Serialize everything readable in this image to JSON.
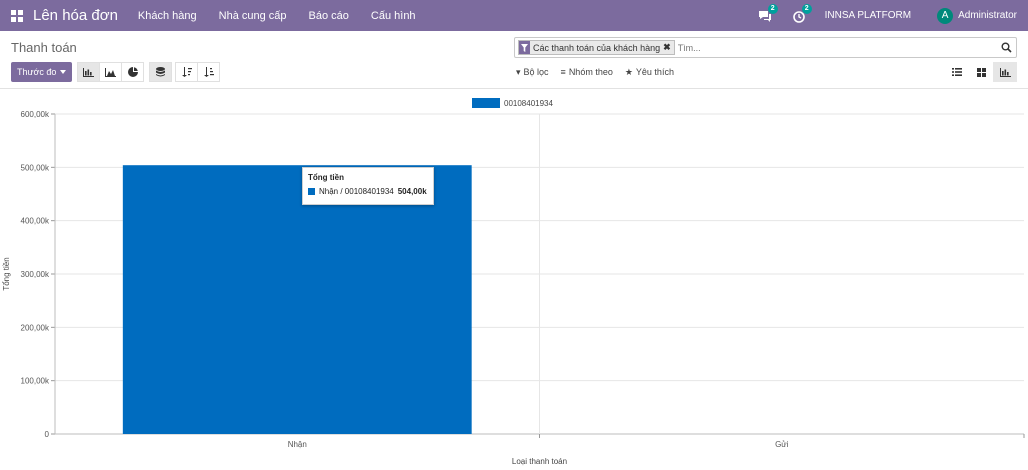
{
  "navbar": {
    "app_title": "Lên hóa đơn",
    "menus": [
      "Khách hàng",
      "Nhà cung cấp",
      "Báo cáo",
      "Cấu hình"
    ],
    "messages_badge": "2",
    "activities_badge": "2",
    "company": "INNSA PLATFORM",
    "avatar_letter": "A",
    "user": "Administrator"
  },
  "control_panel": {
    "breadcrumb": "Thanh toán",
    "search": {
      "facet": "Các thanh toán của khách hàng",
      "facet_remove": "✖",
      "placeholder": "Tìm..."
    },
    "measure_button": "Thước đo",
    "filter_label": "Bộ lọc",
    "groupby_label": "Nhóm theo",
    "favorites_label": "Yêu thích"
  },
  "colors": {
    "brand": "#7c6b9e",
    "bar": "#006cbf",
    "badge": "#00a09d"
  },
  "chart_data": {
    "type": "bar",
    "categories": [
      "Nhận",
      "Gửi"
    ],
    "series": [
      {
        "name": "00108401934",
        "values": [
          504000,
          0
        ]
      }
    ],
    "xlabel": "Loại thanh toán",
    "ylabel": "Tổng tiền",
    "ylim": [
      0,
      600000
    ],
    "yticks": [
      0,
      100000,
      200000,
      300000,
      400000,
      500000,
      600000
    ],
    "ytick_labels": [
      "0",
      "100,00k",
      "200,00k",
      "300,00k",
      "400,00k",
      "500,00k",
      "600,00k"
    ],
    "grid": true,
    "legend_position": "top"
  },
  "tooltip": {
    "title": "Tổng tiền",
    "label": "Nhận / 00108401934",
    "value": "504,00k"
  }
}
